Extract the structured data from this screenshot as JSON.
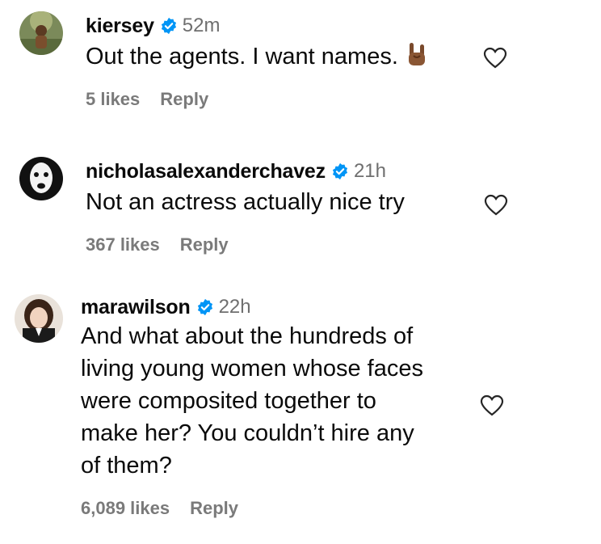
{
  "comments": [
    {
      "username": "kiersey",
      "time": "52m",
      "text": "Out the agents. I want names.",
      "likes": "5 likes",
      "reply": "Reply"
    },
    {
      "username": "nicholasalexanderchavez",
      "time": "21h",
      "text": "Not an actress actually nice try",
      "likes": "367 likes",
      "reply": "Reply"
    },
    {
      "username": "marawilson",
      "time": "22h",
      "text_lines": [
        "And what about the hundreds of",
        "living young women whose faces",
        "were composited together to",
        "make her? You couldn’t hire any",
        "of them?"
      ],
      "likes": "6,089 likes",
      "reply": "Reply"
    }
  ],
  "colors": {
    "verified": "#0095f6",
    "meta": "#7a7a7a",
    "time": "#6f6f6f"
  },
  "icons": {
    "verified": "verified-badge-icon",
    "like": "heart-outline-icon",
    "emoji": "sign-of-the-horns-emoji"
  }
}
